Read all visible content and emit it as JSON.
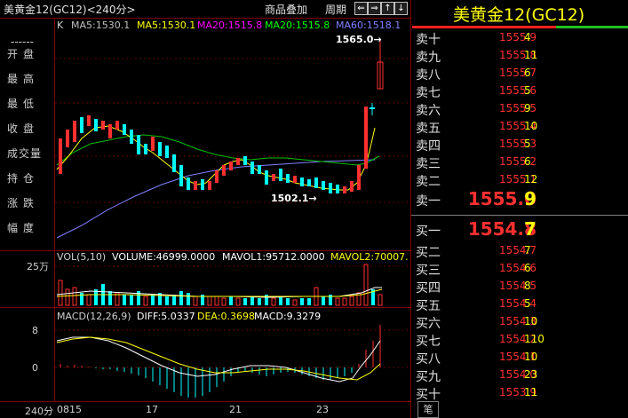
{
  "header": {
    "title": "美黄金12(GC12)<240分>",
    "add_product_label": "商品叠加",
    "period_label": "周期",
    "nav_buttons": [
      "⇐",
      "⇒",
      "↑",
      "↓"
    ]
  },
  "side_panel": {
    "dash": "------",
    "items": [
      {
        "label": "开盘"
      },
      {
        "label": "最高"
      },
      {
        "label": "最低"
      },
      {
        "label": "收盘"
      },
      {
        "label": "成交量"
      },
      {
        "label": "持仓"
      },
      {
        "label": "涨跌"
      },
      {
        "label": "幅度"
      }
    ]
  },
  "main_chart": {
    "k_label": "K",
    "ma_indicators": [
      {
        "text": "MA5:1530.1",
        "color": "#ffffff"
      },
      {
        "text": "MA5:1530.1",
        "color": "#ffff00"
      },
      {
        "text": "MA20:1515.8",
        "color": "#ff00ff"
      },
      {
        "text": "MA20:1515.8",
        "color": "#00ff00"
      },
      {
        "text": "MA60:1518.1",
        "color": "#8080ff"
      }
    ],
    "high_annotation": "1565.0→",
    "low_annotation": "1502.1→"
  },
  "volume_chart": {
    "label": "VOL(5,10)",
    "volume": "VOLUME:46999.0000",
    "mavol1": "MAVOL1:95712.0000",
    "mavol2": "MAVOL2:70007.",
    "axis_label": "25万"
  },
  "macd_chart": {
    "label": "MACD(12,26,9)",
    "diff": "DIFF:5.0337",
    "dea": "DEA:0.3698",
    "macd": "MACD:9.3279",
    "axis_labels": [
      "8",
      "0"
    ]
  },
  "x_axis": {
    "period_label": "240分",
    "ticks": [
      "0815",
      "17",
      "21",
      "23"
    ]
  },
  "order_book": {
    "title": "美黄金12(GC12)",
    "asks": [
      {
        "label": "卖十",
        "price": "1555.9",
        "volume": "4"
      },
      {
        "label": "卖九",
        "price": "1555.8",
        "volume": "11"
      },
      {
        "label": "卖八",
        "price": "1555.7",
        "volume": "6"
      },
      {
        "label": "卖七",
        "price": "1555.6",
        "volume": "5"
      },
      {
        "label": "卖六",
        "price": "1555.5",
        "volume": "9"
      },
      {
        "label": "卖五",
        "price": "1555.4",
        "volume": "10"
      },
      {
        "label": "卖四",
        "price": "1555.3",
        "volume": "5"
      },
      {
        "label": "卖三",
        "price": "1555.2",
        "volume": "6"
      },
      {
        "label": "卖二",
        "price": "1555.1",
        "volume": "12"
      }
    ],
    "best_ask": {
      "label": "卖一",
      "price": "1555.0",
      "volume": "9"
    },
    "best_bid": {
      "label": "买一",
      "price": "1554.8",
      "volume": "7"
    },
    "bids": [
      {
        "label": "买二",
        "price": "1554.7",
        "volume": "7"
      },
      {
        "label": "买三",
        "price": "1554.6",
        "volume": "6"
      },
      {
        "label": "买四",
        "price": "1554.5",
        "volume": "8"
      },
      {
        "label": "买五",
        "price": "1554.4",
        "volume": "5"
      },
      {
        "label": "买六",
        "price": "1554.3",
        "volume": "10"
      },
      {
        "label": "买七",
        "price": "1554.2",
        "volume": "110"
      },
      {
        "label": "买八",
        "price": "1554.1",
        "volume": "10"
      },
      {
        "label": "买九",
        "price": "1554.0",
        "volume": "23"
      },
      {
        "label": "买十",
        "price": "1553.9",
        "volume": "11"
      }
    ],
    "bottom_tab": "笔"
  },
  "colors": {
    "up": "#ff3030",
    "down": "#00ffff",
    "grid": "#800000",
    "ma5": "#ffff00",
    "ma20": "#00ff00",
    "ma60": "#8080ff"
  }
}
